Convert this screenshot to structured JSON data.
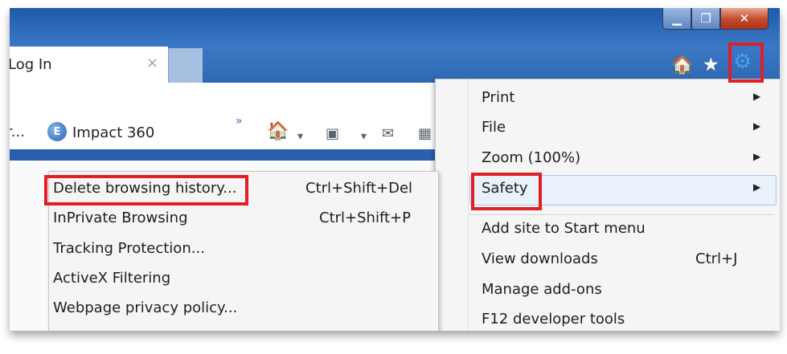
{
  "window": {
    "minimize_glyph": "▁",
    "maximize_glyph": "❐",
    "close_glyph": "✕"
  },
  "tab": {
    "title": "Log In",
    "close_glyph": "×"
  },
  "commandbar": {
    "home_glyph": "🏠",
    "star_glyph": "★",
    "gear_glyph": "⚙"
  },
  "favorites": {
    "truncated_item": "r...",
    "impact_badge": "E",
    "impact_label": "Impact 360",
    "overflow_glyph": "»"
  },
  "toolbar_icons": [
    "🏠",
    "▾",
    "▣",
    "▾",
    "✉",
    "▦"
  ],
  "main_menu": {
    "items": [
      {
        "label": "Print",
        "has_submenu": true
      },
      {
        "label": "File",
        "has_submenu": true
      },
      {
        "label": "Zoom (100%)",
        "has_submenu": true
      },
      {
        "label": "Safety",
        "has_submenu": true,
        "highlighted": true
      },
      {
        "label": "Add site to Start menu"
      },
      {
        "label": "View downloads",
        "shortcut": "Ctrl+J"
      },
      {
        "label": "Manage add-ons"
      },
      {
        "label": "F12 developer tools"
      }
    ],
    "arrow_glyph": "▶"
  },
  "safety_menu": {
    "items": [
      {
        "label": "Delete browsing history...",
        "shortcut": "Ctrl+Shift+Del"
      },
      {
        "label": "InPrivate Browsing",
        "shortcut": "Ctrl+Shift+P"
      },
      {
        "label": "Tracking Protection..."
      },
      {
        "label": "ActiveX Filtering"
      },
      {
        "label": "Webpage privacy policy..."
      }
    ]
  },
  "colors": {
    "highlight_box": "#e01f26",
    "titlebar": "#2f6cba"
  }
}
